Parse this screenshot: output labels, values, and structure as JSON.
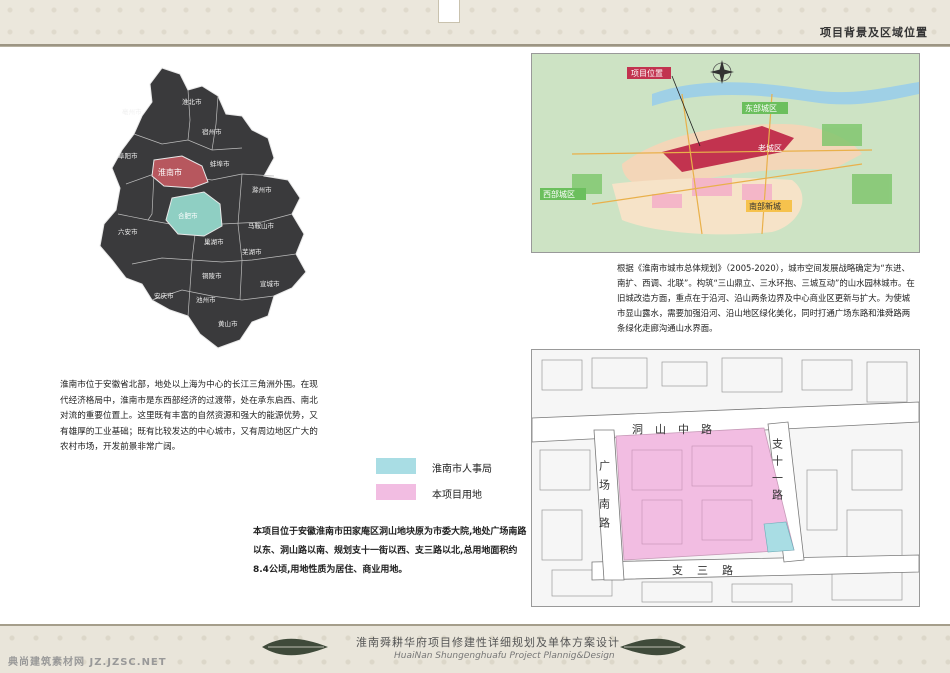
{
  "header": {
    "title": "项目背景及区域位置"
  },
  "province_map": {
    "cities": [
      "亳州市",
      "宿州市",
      "淮北市",
      "阜阳市",
      "蚌埠市",
      "淮南市",
      "滁州市",
      "合肥市",
      "六安市",
      "马鞍山市",
      "芜湖市",
      "巢湖市",
      "铜陵市",
      "安庆市",
      "池州市",
      "宣城市",
      "黄山市"
    ],
    "highlight_huainan": "淮南市",
    "highlight_hefei": "合肥市"
  },
  "left_text": "淮南市位于安徽省北部，地处以上海为中心的长江三角洲外围。在现代经济格局中，淮南市是东西部经济的过渡带，处在承东启西、南北对流的重要位置上。这里既有丰富的自然资源和强大的能源优势，又有雄厚的工业基础；既有比较发达的中心城市，又有周边地区广大的农村市场，开发前景非常广阔。",
  "legend": [
    {
      "label": "淮南市人事局",
      "color": "#a9dde4"
    },
    {
      "label": "本项目用地",
      "color": "#f2bde2"
    }
  ],
  "project_text": "本项目位于安徽淮南市田家庵区洞山地块原为市委大院,地处广场南路以东、洞山路以南、规划支十一街以西、支三路以北,总用地面积约8.4公顷,用地性质为居住、商业用地。",
  "city_map": {
    "labels": {
      "project": "项目位置",
      "east": "东部城区",
      "old": "老城区",
      "west": "西部城区",
      "south": "南部新城"
    }
  },
  "right_text": "根据《淮南市城市总体规划》（2005-2020），城市空间发展战略确定为“东进、南扩、西调、北联”。构筑“三山鼎立、三水环抱、三城互动”的山水园林城市。在旧城改造方面，重点在于沿河、沿山两条边界及中心商业区更新与扩大。为使城市显山露水，需要加强沿河、沿山地区绿化美化，同时打通广场东路和淮舜路两条绿化走廊沟通山水界面。",
  "site_map": {
    "roads": {
      "north": "洞山中路",
      "east": "支十一路",
      "west": "广场南路",
      "south": "支三路"
    },
    "colors": {
      "project": "#f2bde2",
      "bureau": "#a9dde4"
    }
  },
  "footer": {
    "title_cn": "淮南舜耕华府项目修建性详细规划及单体方案设计",
    "title_en": "HuaiNan Shungenghuafu Project Plannig&Design",
    "watermark": "典尚建筑素材网 JZ.JZSC.NET"
  }
}
